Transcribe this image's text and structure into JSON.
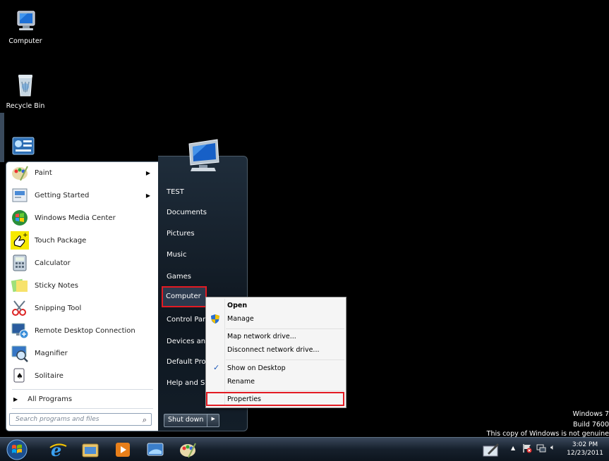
{
  "desktop": {
    "icons": [
      {
        "label": "Computer",
        "icon": "computer-icon"
      },
      {
        "label": "Recycle Bin",
        "icon": "recycle-bin-icon"
      }
    ]
  },
  "start_menu": {
    "programs": [
      {
        "label": "Paint",
        "icon": "paint-icon",
        "submenu": true
      },
      {
        "label": "Getting Started",
        "icon": "getting-started-icon",
        "submenu": true
      },
      {
        "label": "Windows Media Center",
        "icon": "media-center-icon",
        "submenu": false
      },
      {
        "label": "Touch Package",
        "icon": "touch-package-icon",
        "submenu": false
      },
      {
        "label": "Calculator",
        "icon": "calculator-icon",
        "submenu": false
      },
      {
        "label": "Sticky Notes",
        "icon": "sticky-notes-icon",
        "submenu": false
      },
      {
        "label": "Snipping Tool",
        "icon": "snipping-tool-icon",
        "submenu": false
      },
      {
        "label": "Remote Desktop Connection",
        "icon": "remote-desktop-icon",
        "submenu": false
      },
      {
        "label": "Magnifier",
        "icon": "magnifier-icon",
        "submenu": false
      },
      {
        "label": "Solitaire",
        "icon": "solitaire-icon",
        "submenu": false
      }
    ],
    "all_programs": "All Programs",
    "search_placeholder": "Search programs and files",
    "right_items": [
      "TEST",
      "Documents",
      "Pictures",
      "Music",
      "Games",
      "Computer",
      "Control Panel",
      "Devices and Printers",
      "Default Programs",
      "Help and Support"
    ],
    "shutdown_label": "Shut down"
  },
  "context_menu": {
    "items": [
      "Open",
      "Manage",
      "Map network drive...",
      "Disconnect network drive...",
      "Show on Desktop",
      "Rename",
      "Properties"
    ],
    "checked_item": "Show on Desktop"
  },
  "watermark": {
    "line1": "Windows 7",
    "line2": "Build 7600",
    "line3": "This copy of Windows is not genuine"
  },
  "taskbar": {
    "time": "3:02 PM",
    "date": "12/23/2011"
  },
  "colors": {
    "highlight_border": "#e31b23",
    "start_menu_dark": "#1f2d3b"
  }
}
